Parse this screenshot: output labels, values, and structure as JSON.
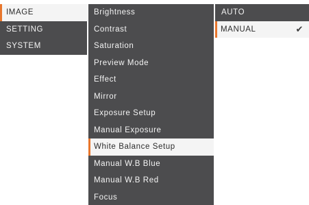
{
  "menu": {
    "main": [
      {
        "label": "IMAGE",
        "selected": true
      },
      {
        "label": "SETTING",
        "selected": false
      },
      {
        "label": "SYSTEM",
        "selected": false
      }
    ],
    "sub": [
      {
        "label": "Brightness"
      },
      {
        "label": "Contrast"
      },
      {
        "label": "Saturation"
      },
      {
        "label": "Preview Mode"
      },
      {
        "label": "Effect"
      },
      {
        "label": "Mirror"
      },
      {
        "label": "Exposure Setup"
      },
      {
        "label": "Manual Exposure"
      },
      {
        "label": "White Balance Setup",
        "selected": true
      },
      {
        "label": "Manual W.B Blue"
      },
      {
        "label": "Manual W.B Red"
      },
      {
        "label": "Focus"
      }
    ],
    "options": [
      {
        "label": "AUTO"
      },
      {
        "label": "MANUAL",
        "selected": true,
        "checked": true
      }
    ],
    "check_glyph": "✔"
  },
  "colors": {
    "panel": "#4c4c4e",
    "text": "#f4f4f4",
    "highlight_bg": "#f4f4f4",
    "highlight_text": "#2b2b2b",
    "accent": "#e8762c"
  }
}
